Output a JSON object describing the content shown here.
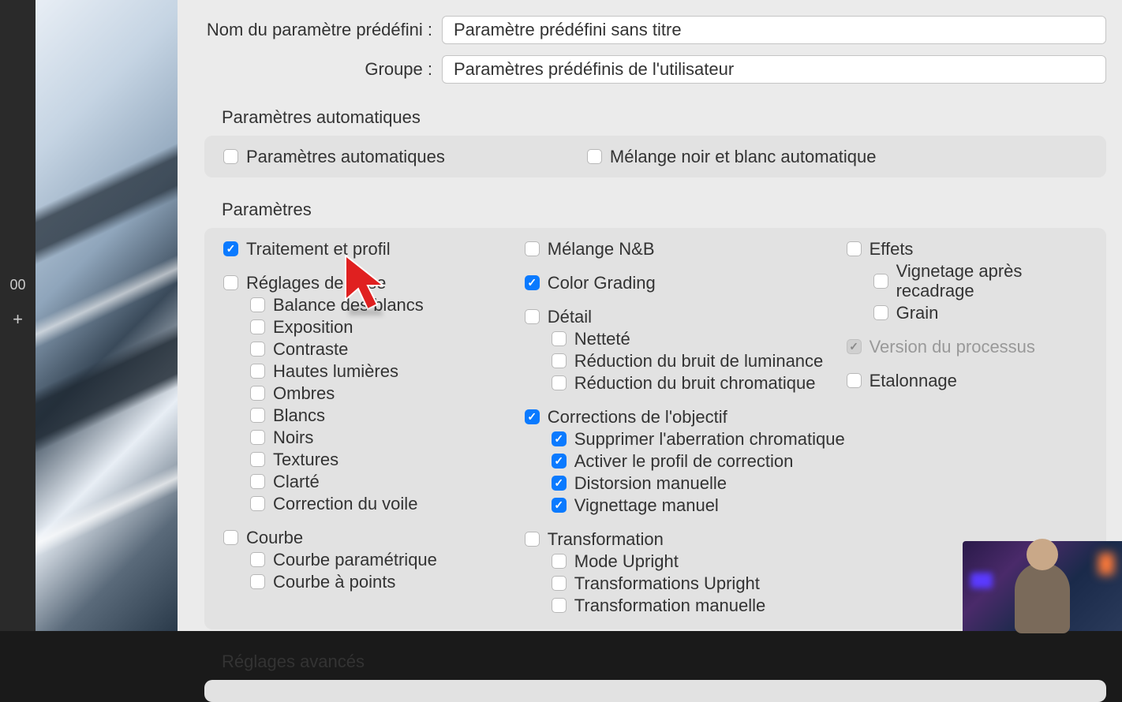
{
  "sidebar": {
    "value": "00",
    "plus": "+"
  },
  "form": {
    "presetNameLabel": "Nom du paramètre prédéfini :",
    "presetNameValue": "Paramètre prédéfini sans titre",
    "groupLabel": "Groupe :",
    "groupValue": "Paramètres prédéfinis de l'utilisateur"
  },
  "sections": {
    "autoParams": {
      "title": "Paramètres automatiques",
      "items": {
        "auto": "Paramètres automatiques",
        "bwAuto": "Mélange noir et blanc automatique"
      }
    },
    "params": {
      "title": "Paramètres",
      "col1": {
        "treatment": "Traitement et profil",
        "basic": "Réglages de base",
        "wb": "Balance des blancs",
        "expo": "Exposition",
        "contrast": "Contraste",
        "highlights": "Hautes lumières",
        "shadows": "Ombres",
        "whites": "Blancs",
        "blacks": "Noirs",
        "textures": "Textures",
        "clarity": "Clarté",
        "dehaze": "Correction du voile",
        "curve": "Courbe",
        "paramCurve": "Courbe paramétrique",
        "pointCurve": "Courbe à points"
      },
      "col2": {
        "bwMix": "Mélange N&B",
        "colorGrading": "Color Grading",
        "detail": "Détail",
        "sharpness": "Netteté",
        "lumNoise": "Réduction du bruit de luminance",
        "chromNoise": "Réduction du bruit chromatique",
        "lensCorr": "Corrections de l'objectif",
        "removeCA": "Supprimer l'aberration chromatique",
        "enableProfile": "Activer le profil de correction",
        "manualDist": "Distorsion manuelle",
        "manualVig": "Vignettage manuel",
        "transform": "Transformation",
        "upright": "Mode Upright",
        "uprightTrans": "Transformations Upright",
        "manualTrans": "Transformation manuelle"
      },
      "col3": {
        "effects": "Effets",
        "postVig": "Vignetage après recadrage",
        "grain": "Grain",
        "processVer": "Version du processus",
        "calibration": "Etalonnage"
      }
    },
    "advanced": {
      "title": "Réglages avancés"
    }
  }
}
